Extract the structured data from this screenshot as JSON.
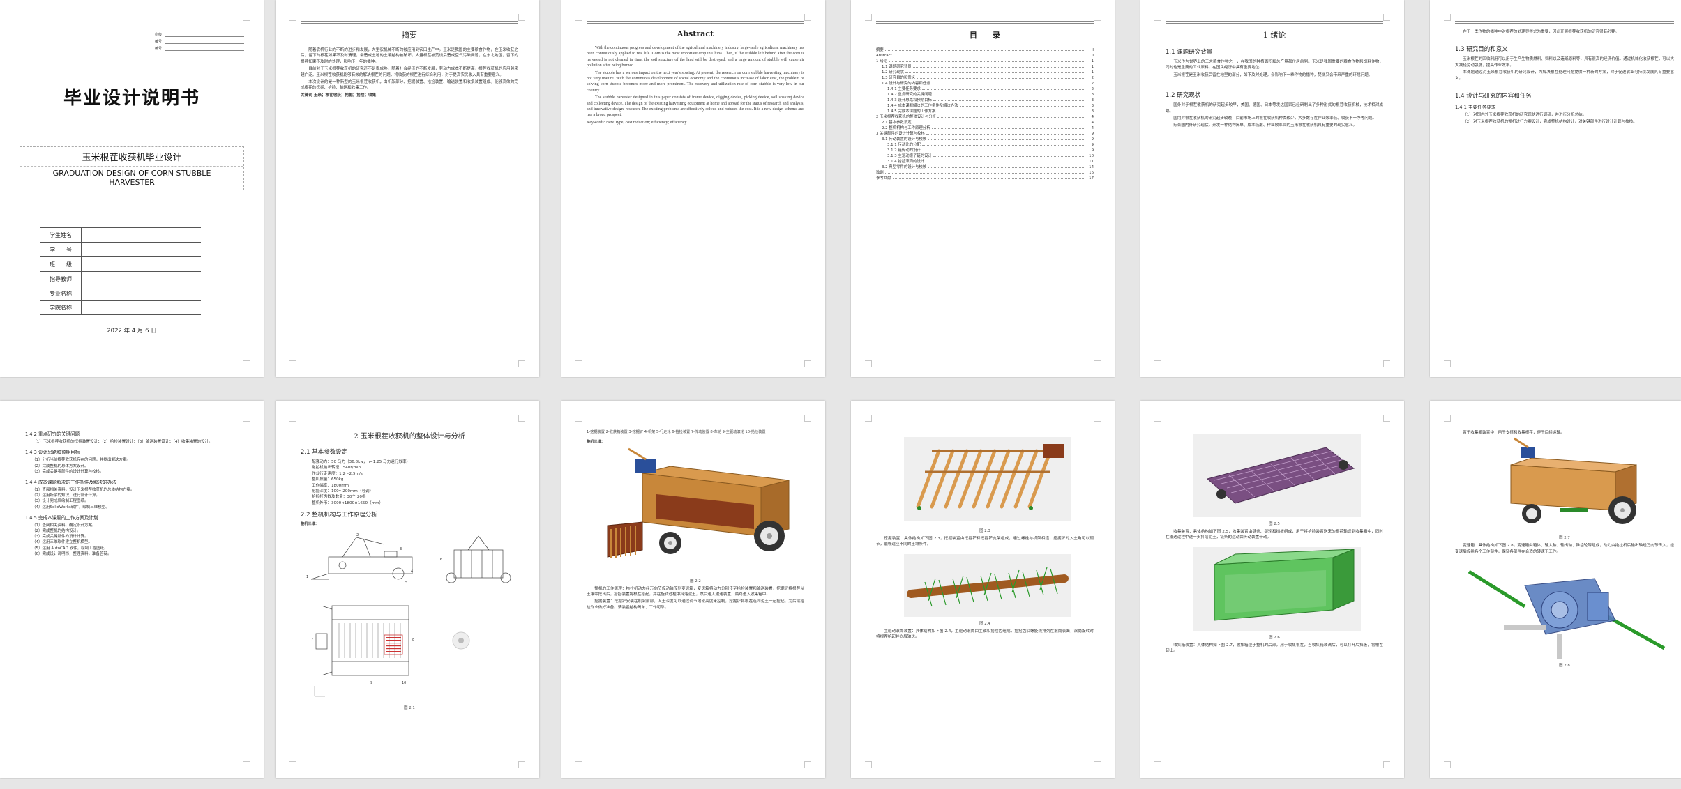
{
  "cover": {
    "stamp_labels": [
      "密级",
      "编号",
      "编号"
    ],
    "title": "毕业设计说明书",
    "subtitle_cn": "玉米根茬收获机毕业设计",
    "subtitle_en": "GRADUATION DESIGN OF CORN STUBBLE HARVESTER",
    "fields": [
      "学生姓名",
      "学　　号",
      "班　　级",
      "指导教师",
      "专业名称",
      "学院名称"
    ],
    "date": "2022 年 4 月 6 日"
  },
  "abstract_cn": {
    "title": "摘要",
    "paragraphs": [
      "随着农机行业的不断的进步和发展，大型农机械不断的被应用到农田生产中。玉米是我国的主要粮食作物，在玉米收获之后，留下的根茬如果不及时清理，会造成土地的土壤结构被破坏，大量根茬被焚烧后造成空气污染问题，在东北地区，留下的根茬如果不及时的处理，影响下一年的播种。",
      "目前对于玉米根茬收获机的研究还不是很成熟，随着社会经济的不断发展，劳动力成本不断提高，根茬收获机的应用越来越广泛。玉米根茬收获机能够有效的解决根茬的问题，将收获的根茬进行综合利用，对于提高农民收入具有重要意义。",
      "本次设计的是一种新型的玉米根茬收获机，由机架部分、挖掘装置、拾捡装置、输送装置和收集装置组成。能够高效的完成根茬的挖掘、拾捡、输送和收集工作。"
    ],
    "keywords": "关键词 玉米；根茬收获；挖掘；拾捡；收集"
  },
  "abstract_en": {
    "title": "Abstract",
    "paragraphs": [
      "With the continuous progress and development of the agricultural machinery industry, large-scale agricultural machinery has been continuously applied to real life. Corn is the most important crop in China. Then, if the stubble left behind after the corn is harvested is not cleaned in time, the soil structure of the land will be destroyed, and a large amount of stubble will cause air pollution after being burned.",
      "The stubble has a serious impact on the next year's sowing. At present, the research on corn stubble harvesting machinery is not very mature. With the continuous development of social economy and the continuous increase of labor cost, the problem of solving corn stubble becomes more and more prominent. The recovery and utilization rate of corn stubble is very low in our country.",
      "The stubble harvester designed in this paper consists of frame device, digging device, picking device, soil shaking device and collecting device. The design of the existing harvesting equipment at home and abroad for the status of research and analysis, and innovative design, research. The existing problems are effectively solved and reduces the cost. It is a new design scheme and has a broad prospect."
    ],
    "keywords": "Keywords: New Type; cost reduction; efficiency; efficiency"
  },
  "toc": {
    "title": "目　　录",
    "rows": [
      {
        "label": "摘要",
        "page": "I",
        "level": 1
      },
      {
        "label": "Abstract",
        "page": "II",
        "level": 1
      },
      {
        "label": "1 绪论",
        "page": "1",
        "level": 1
      },
      {
        "label": "1.1 课题研究背景",
        "page": "1",
        "level": 2
      },
      {
        "label": "1.2 研究现状",
        "page": "1",
        "level": 2
      },
      {
        "label": "1.3 研究目的和意义",
        "page": "2",
        "level": 2
      },
      {
        "label": "1.4 设计与研究的内容和任务",
        "page": "2",
        "level": 2
      },
      {
        "label": "1.4.1 主要任务要求",
        "page": "2",
        "level": 3
      },
      {
        "label": "1.4.2 重点研究的关键问题",
        "page": "3",
        "level": 3
      },
      {
        "label": "1.4.3 设计思路和预期目标",
        "page": "3",
        "level": 3
      },
      {
        "label": "1.4.4 成本课题解决的工作条件及解决办法",
        "page": "3",
        "level": 3
      },
      {
        "label": "1.4.5 完成本课题的工作方案",
        "page": "3",
        "level": 3
      },
      {
        "label": "2 玉米根茬收获机的整体设计与分析",
        "page": "4",
        "level": 1
      },
      {
        "label": "2.1 基本参数设定",
        "page": "4",
        "level": 2
      },
      {
        "label": "2.2 整机机构与工作原理分析",
        "page": "4",
        "level": 2
      },
      {
        "label": "3 关键部件的设计计算与校核",
        "page": "9",
        "level": 1
      },
      {
        "label": "3.1 传动装置的设计与校核",
        "page": "9",
        "level": 2
      },
      {
        "label": "3.1.1 传动比的分配",
        "page": "9",
        "level": 3
      },
      {
        "label": "3.1.2 链传动的设计",
        "page": "9",
        "level": 3
      },
      {
        "label": "3.1.3 主驱动滚子链的设计",
        "page": "10",
        "level": 3
      },
      {
        "label": "3.1.4 拾捡滚筒的设计",
        "page": "11",
        "level": 3
      },
      {
        "label": "3.2 典型零件的设计与校核",
        "page": "14",
        "level": 2
      },
      {
        "label": "致谢",
        "page": "16",
        "level": 1
      },
      {
        "label": "参考文献",
        "page": "17",
        "level": 1
      }
    ]
  },
  "intro": {
    "title": "1 绪论",
    "s11": "1.1 课题研究背景",
    "s11_text": [
      "玉米作为世界上的三大粮食作物之一，在我国的种植面积和总产量都位居前列。玉米是我国重要的粮食作物和饲料作物，同时也是重要的工业原料，在国民经济中具有重要地位。",
      "玉米根茬是玉米收获后留在地里的部分，如不及时处理，会影响下一季作物的播种，焚烧又会带来严重的环境问题。"
    ],
    "s12": "1.2 研究现状",
    "s12_text": [
      "国外对于根茬收获机的研究起步较早，美国、德国、日本等发达国家已经研制出了多种形式的根茬收获机械，技术相对成熟。",
      "国内对根茬收获机的研究起步较晚，目前市场上的根茬收获机种类较少，大多数存在作业效率低、收获不干净等问题。",
      "综合国内外研究现状，开发一种结构简单、成本低廉、作业效率高的玉米根茬收获机具有重要的现实意义。"
    ]
  },
  "p6": {
    "lead": "在下一季作物的播种中对根茬的处理显得尤为重要，因此开展根茬收获机的研究很有必要。",
    "s13": "1.3 研究目的和意义",
    "s13_text": [
      "玉米根茬的回收利用可以用于生产生物质燃料、饲料以及造纸原料等，具有很高的经济价值。通过机械化收获根茬，可以大大减轻劳动强度，提高作业效率。",
      "本课题通过对玉米根茬收获机的研究设计，为解决根茬处理问题提供一种新的方案，对于促进农业可持续发展具有重要意义。"
    ],
    "s14": "1.4 设计与研究的内容和任务",
    "s141": "1.4.1 主要任务要求",
    "s141_text": [
      "（1）对国内外玉米根茬收获机的研究现状进行调研，并进行分析总结。",
      "（2）对玉米根茬收获机的整机进行方案设计，完成整机结构设计，对关键部件进行设计计算与校核。"
    ]
  },
  "p7": {
    "h142": "1.4.2 重点研究的关键问题",
    "t142": "（1）玉米根茬收获机的挖掘装置设计；（2）拾捡装置设计；（3）输送装置设计；（4）收集装置的设计。",
    "h143": "1.4.3 设计思路和预期目标",
    "items143": [
      "（1）分析当前根茬收获机存在的问题，并提出解决方案。",
      "（2）完成整机的总体方案设计。",
      "（3）完成关键零部件的设计计算与校核。"
    ],
    "h144": "1.4.4 成本课题解决的工作条件及解决的办法",
    "items144": [
      "（1）查阅相关资料，设计玉米根茬收获机的总体结构方案。",
      "（2）运用所学的知识，进行设计计算。",
      "（3）设计完成后绘制工程图纸。",
      "（4）运用SolidWorks软件，绘制三维模型。"
    ],
    "h145": "1.4.5 完成本课题的工作方案及计划",
    "items145": [
      "（1）查阅相关资料，确定设计方案。",
      "（2）完成整机的结构设计。",
      "（3）完成关键部件的设计计算。",
      "（4）运用三维软件建立整机模型。",
      "（5）运用 AutoCAD 软件，绘制工程图纸。",
      "（6）完成设计说明书，整理资料，准备答辩。"
    ]
  },
  "p8": {
    "title": "2 玉米根茬收获机的整体设计与分析",
    "s21": "2.1 基本参数设定",
    "specs": [
      "配套动力：50 马力（36.8kw，n=1.25 马力运行效率）",
      "拖拉机输出转速：540r/min",
      "作业行走速度：1.2～2.5m/s",
      "整机质量：650kg",
      "工作幅宽：1800mm",
      "挖掘深度：100～200mm（可调）",
      "拾捡杆齿数及数量：30个 20根",
      "整机外形：3000×1800×1650（mm）"
    ],
    "s22": "2.2 整机机构与工作原理分析",
    "fig_label": "整机三维：",
    "fig_cap": "图 2.1",
    "labels": [
      "1",
      "2",
      "3",
      "4",
      "5",
      "6",
      "7",
      "8",
      "9",
      "10"
    ]
  },
  "p9": {
    "legend": "1-挖掘装置 2-收获箱装置 3-挖掘铲 4-机架 5-行走轮 6-拾捡装置 7-传动装置 8-车轮 9-主驱动滚轮 10-拾捡装置",
    "fig_label": "整机三维：",
    "fig_cap": "图 2.2",
    "text": [
      "整机的工作原理：拖拉机动力经万向节传动轴传到变速箱，变速箱将动力分别传至拾捡装置和输送装置，挖掘铲将根茬从土壤中挖出后，拾捡装置将根茬拾起，并在旋转过程中抖落泥土，然后送入输送装置，最终进入收集箱中。",
      "挖掘装置：挖掘铲安装在机架前部，入土深度可以通过调节地轮高度来控制，挖掘铲将根茬连同泥土一起挖起，为后续拾捡作业做好准备。该装置结构简单、工作可靠。"
    ]
  },
  "p10": {
    "cap1": "图 2.3",
    "text1": "挖掘装置：具体结构如下图 2.3，挖掘装置由挖掘铲和挖掘铲支架组成，通过螺栓与机架相连，挖掘铲的入土角可以调节，能够适应不同的土壤条件。",
    "cap2": "图 2.4",
    "text2": "主驱动滚筒装置：具体结构如下图 2.4，主驱动滚筒由主轴和拾捡齿组成，拾捡齿沿螺旋线排列在滚筒表面，滚筒旋转时将根茬拾起并向后输送。"
  },
  "p11": {
    "cap1": "图 2.5",
    "text1": "收集装置：具体结构如下图 2.5，收集装置由链条、链轮和挡板组成，用于将拾捡装置送来的根茬输送到收集箱中，同时在输送过程中进一步抖落泥土，链条的运动由传动装置带动。",
    "cap2": "图 2.6",
    "text2": "收集箱装置：具体结构如下图 2.7，收集箱位于整机的后部，用于收集根茬，当收集箱装满后，可以打开后挡板，将根茬卸出。"
  },
  "p12": {
    "lead": "置于收集箱装置中，用于支撑和收集根茬，便于后续运输。",
    "cap1": "图 2.7",
    "text1": "变速箱：具体结构如下图 2.8，变速箱由箱体、输入轴、输出轴、锥齿轮等组成，动力由拖拉机后输出轴经万向节传入，经变速后传给各个工作部件，保证各部件在合适的转速下工作。",
    "cap2": "图 2.8"
  },
  "colors": {
    "wood": "#c8873a",
    "frame": "#8a3b1b",
    "green": "#3aa83a",
    "blue": "#5a7fbf",
    "purple": "#7a4f82"
  }
}
